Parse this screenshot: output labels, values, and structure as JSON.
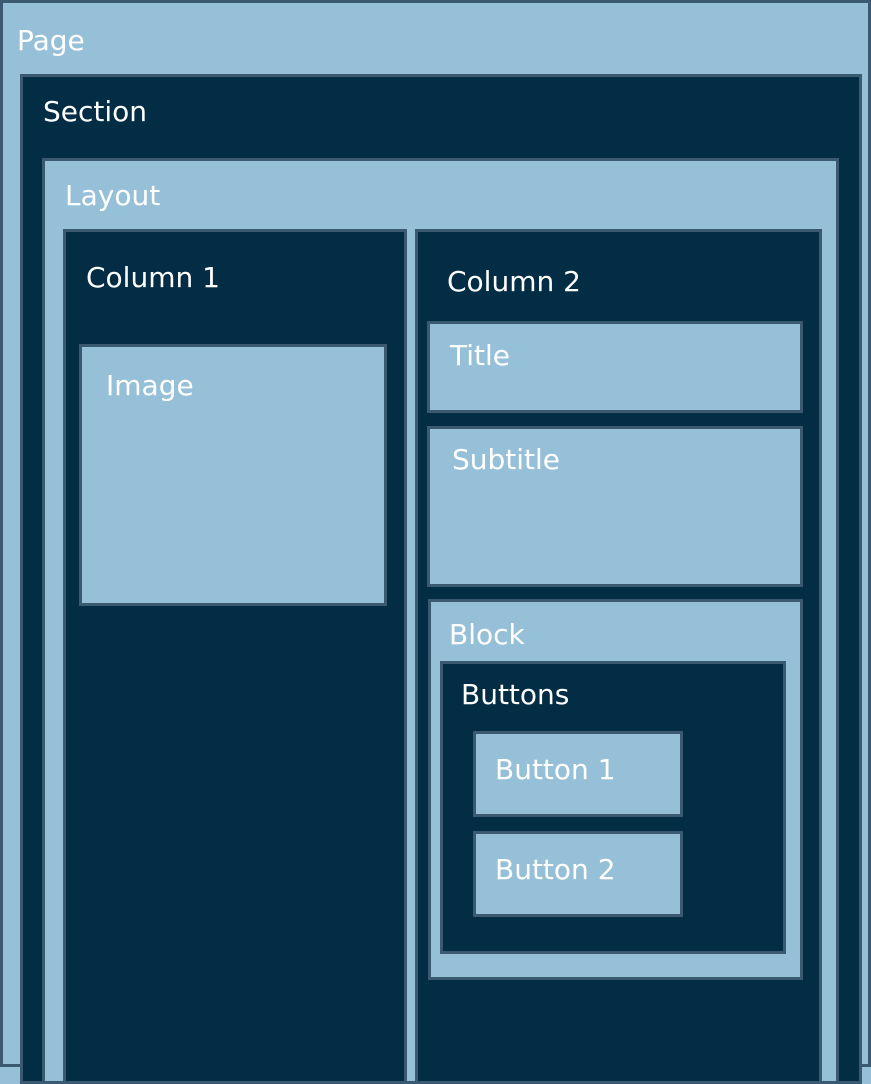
{
  "page": {
    "label": "Page"
  },
  "section": {
    "label": "Section"
  },
  "layout": {
    "label": "Layout"
  },
  "column1": {
    "label": "Column 1",
    "image": {
      "label": "Image"
    }
  },
  "column2": {
    "label": "Column 2",
    "title": {
      "label": "Title"
    },
    "subtitle": {
      "label": "Subtitle"
    },
    "block": {
      "label": "Block",
      "buttons": {
        "label": "Buttons",
        "button1": {
          "label": "Button 1"
        },
        "button2": {
          "label": "Button 2"
        }
      }
    }
  },
  "colors": {
    "light": "#96bfd8",
    "dark": "#022d45",
    "border": "#3a5a72",
    "text": "#ffffff"
  }
}
